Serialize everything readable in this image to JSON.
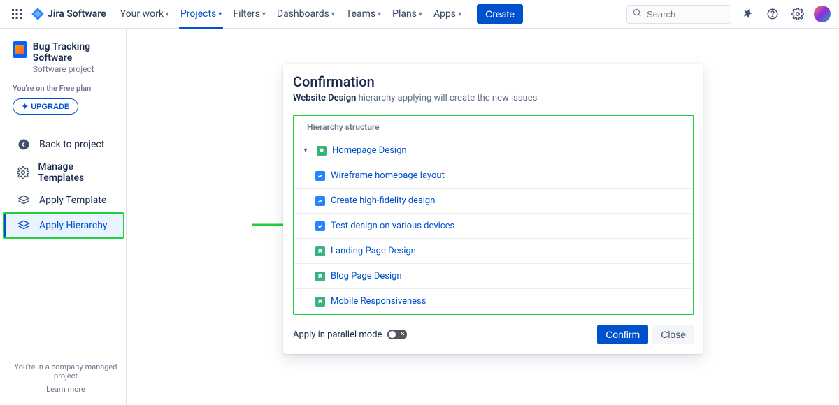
{
  "topnav": {
    "logo": "Jira Software",
    "items": [
      {
        "label": "Your work"
      },
      {
        "label": "Projects",
        "active": true
      },
      {
        "label": "Filters"
      },
      {
        "label": "Dashboards"
      },
      {
        "label": "Teams"
      },
      {
        "label": "Plans"
      },
      {
        "label": "Apps"
      }
    ],
    "create": "Create",
    "search_placeholder": "Search"
  },
  "sidebar": {
    "project_name": "Bug Tracking Software",
    "project_type": "Software project",
    "plan_note": "You're on the Free plan",
    "upgrade": "UPGRADE",
    "items": [
      {
        "label": "Back to project",
        "icon": "back"
      },
      {
        "label": "Manage Templates",
        "icon": "gear",
        "bold": true
      },
      {
        "label": "Apply Template",
        "icon": "layers"
      },
      {
        "label": "Apply Hierarchy",
        "icon": "layers",
        "selected": true
      }
    ],
    "footer_line": "You're in a company-managed project",
    "footer_link": "Learn more"
  },
  "panel": {
    "title": "Confirmation",
    "template_name": "Website Design",
    "subtitle_suffix": " hierarchy applying will create the new issues",
    "structure_heading": "Hierarchy structure",
    "rows": [
      {
        "type": "story",
        "label": "Homepage Design",
        "top": true
      },
      {
        "type": "task",
        "label": "Wireframe homepage layout"
      },
      {
        "type": "task",
        "label": "Create high-fidelity design"
      },
      {
        "type": "task",
        "label": "Test design on various devices"
      },
      {
        "type": "story",
        "label": "Landing Page Design"
      },
      {
        "type": "story",
        "label": "Blog Page Design"
      },
      {
        "type": "story",
        "label": "Mobile Responsiveness"
      }
    ],
    "toggle_label": "Apply in parallel mode",
    "confirm": "Confirm",
    "close": "Close"
  }
}
